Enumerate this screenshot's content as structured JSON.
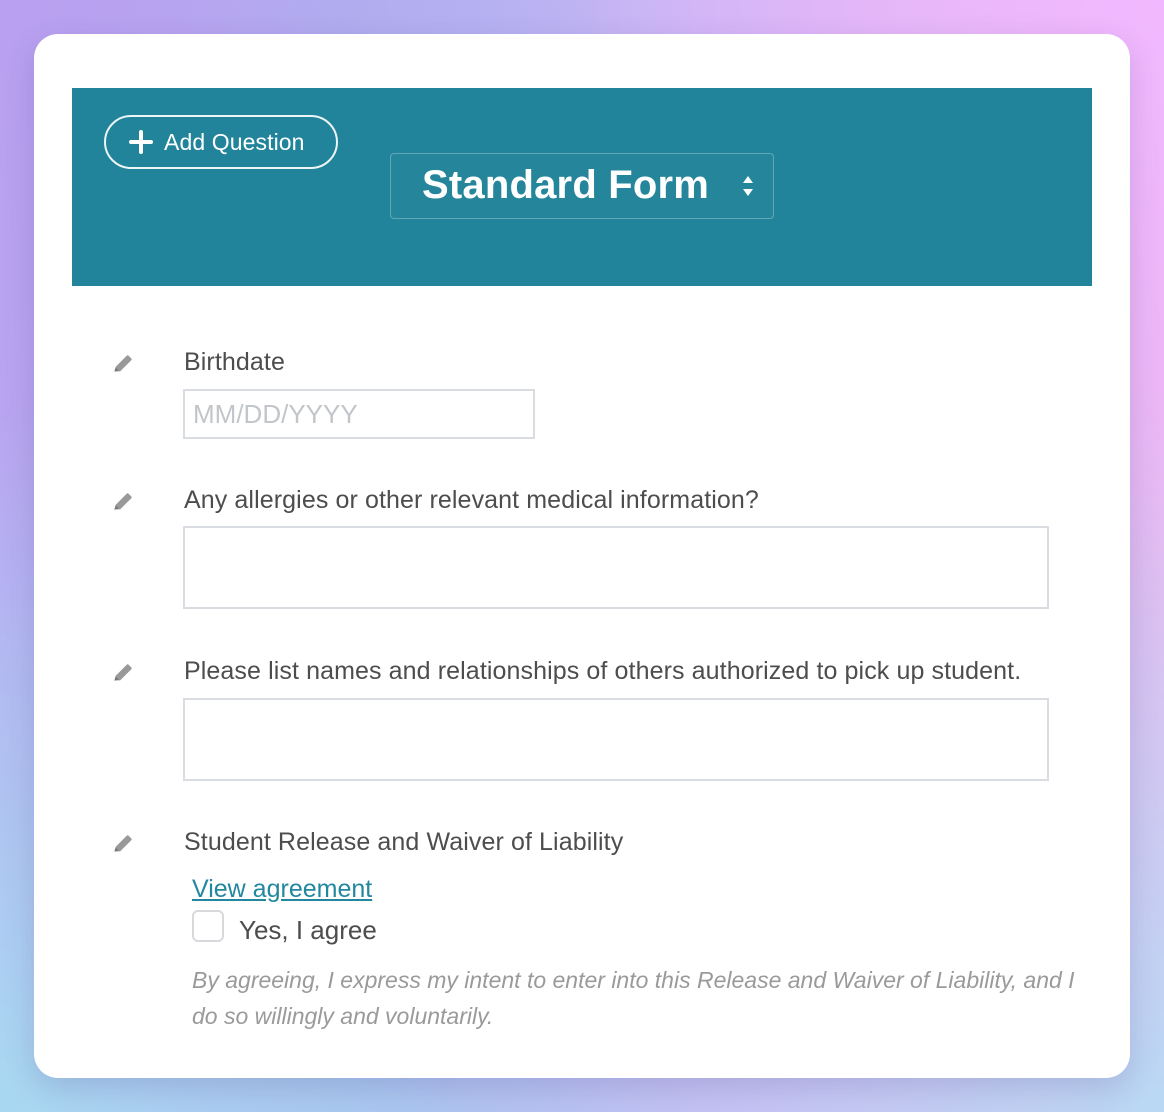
{
  "header": {
    "add_question_label": "Add Question",
    "form_type_label": "Standard Form",
    "background_color": "#21849a"
  },
  "questions": [
    {
      "label": "Birthdate",
      "placeholder": "MM/DD/YYYY",
      "value": ""
    },
    {
      "label": "Any allergies or other relevant medical information?",
      "value": ""
    },
    {
      "label": "Please list names and relationships of others authorized to pick up student.",
      "value": ""
    },
    {
      "label": "Student Release and Waiver of Liability",
      "link_text": "View agreement",
      "checkbox_label": "Yes, I agree",
      "checked": false,
      "disclaimer": "By agreeing, I express my intent to enter into this Release and Waiver of Liability, and I do so willingly and voluntarily."
    }
  ],
  "icons": {
    "add": "plus-icon",
    "select": "select-arrows-icon",
    "edit": "pencil-icon"
  },
  "colors": {
    "link": "#22879f",
    "label_text": "#4d4d4d",
    "muted_text": "#9a9a9a",
    "input_border": "#d9dde1"
  }
}
